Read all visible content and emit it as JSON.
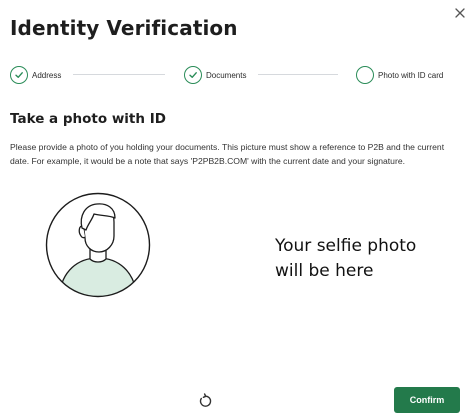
{
  "modal": {
    "title": "Identity Verification"
  },
  "steps": [
    {
      "label": "Address",
      "status": "completed",
      "icon": "check-icon"
    },
    {
      "label": "Documents",
      "status": "completed",
      "icon": "check-icon"
    },
    {
      "label": "Photo with ID card",
      "status": "current",
      "icon": "empty-circle"
    }
  ],
  "section": {
    "heading": "Take a photo with ID",
    "description": "Please provide a photo of you holding your documents. This picture must show a reference to P2B and the current date. For example, it would be a note that says 'P2PB2B.COM' with the current date and your signature."
  },
  "preview": {
    "placeholder_line1": "Your selfie photo",
    "placeholder_line2": "will be here",
    "avatar_icon": "user-silhouette-icon"
  },
  "actions": {
    "retake_icon": "rotate-icon",
    "confirm_label": "Confirm"
  },
  "colors": {
    "accent": "#237a4b",
    "step_ring": "#2a8c58",
    "avatar_fill": "#d9ece1"
  }
}
